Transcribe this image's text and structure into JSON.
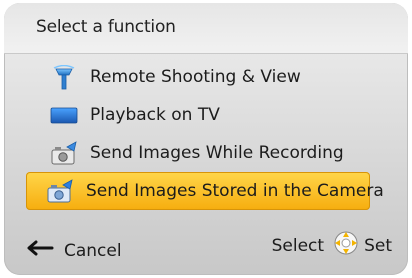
{
  "title": "Select a function",
  "menu": {
    "items": [
      {
        "label": "Remote Shooting & View",
        "icon": "remote-shooting-icon",
        "selected": false
      },
      {
        "label": "Playback on TV",
        "icon": "tv-icon",
        "selected": false
      },
      {
        "label": "Send Images While Recording",
        "icon": "camera-send-icon",
        "selected": false
      },
      {
        "label": "Send Images Stored in the Camera",
        "icon": "camera-send-stored-icon",
        "selected": true
      }
    ]
  },
  "footer": {
    "cancel_label": "Cancel",
    "select_label": "Select",
    "set_label": "Set",
    "back_icon": "back-arrow-icon",
    "dial_icon": "control-dial-icon"
  },
  "colors": {
    "highlight_top": "#ffd64a",
    "highlight_bottom": "#f6ad0e",
    "text": "#1c1c1c"
  }
}
